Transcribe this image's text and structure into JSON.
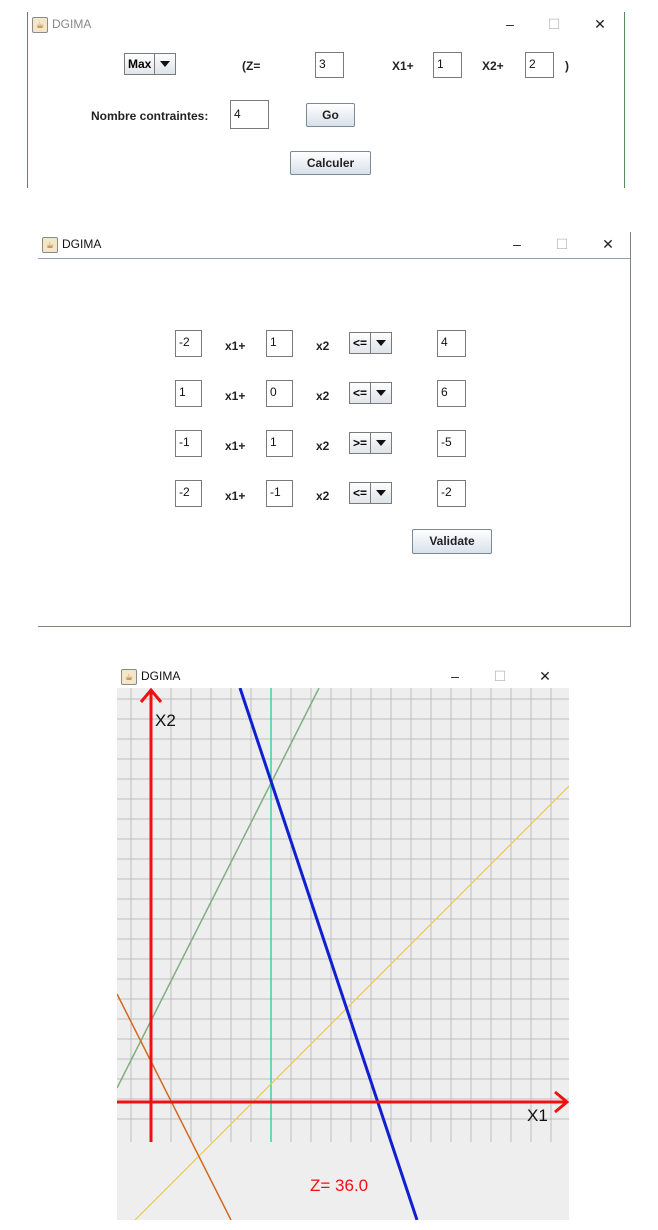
{
  "window1": {
    "title": "DGIMA",
    "objective_type": "Max",
    "z_label": "(Z=",
    "z_value": "3",
    "x1_label": "X1+",
    "x1_coef": "1",
    "x2_label": "X2+",
    "x2_coef": "2",
    "close_paren": ")",
    "constraints_label": "Nombre contraintes:",
    "constraints_count": "4",
    "go_label": "Go",
    "calculer_label": "Calculer"
  },
  "window2": {
    "title": "DGIMA",
    "x1_label": "x1+",
    "x2_label": "x2",
    "constraints": [
      {
        "a": "-2",
        "b": "1",
        "op": "<=",
        "rhs": "4"
      },
      {
        "a": "1",
        "b": "0",
        "op": "<=",
        "rhs": "6"
      },
      {
        "a": "-1",
        "b": "1",
        "op": ">=",
        "rhs": "-5"
      },
      {
        "a": "-2",
        "b": "-1",
        "op": "<=",
        "rhs": "-2"
      }
    ],
    "validate_label": "Validate"
  },
  "window3": {
    "title": "DGIMA",
    "x2_axis_label": "X2",
    "x1_axis_label": "X1",
    "z_result": "Z= 36.0"
  },
  "colors": {
    "axis": "#ee1111",
    "objective_line": "#1020d0",
    "grid": "#bdbdbd",
    "plot_background": "#eeeeee",
    "z_text": "#ee1111"
  }
}
